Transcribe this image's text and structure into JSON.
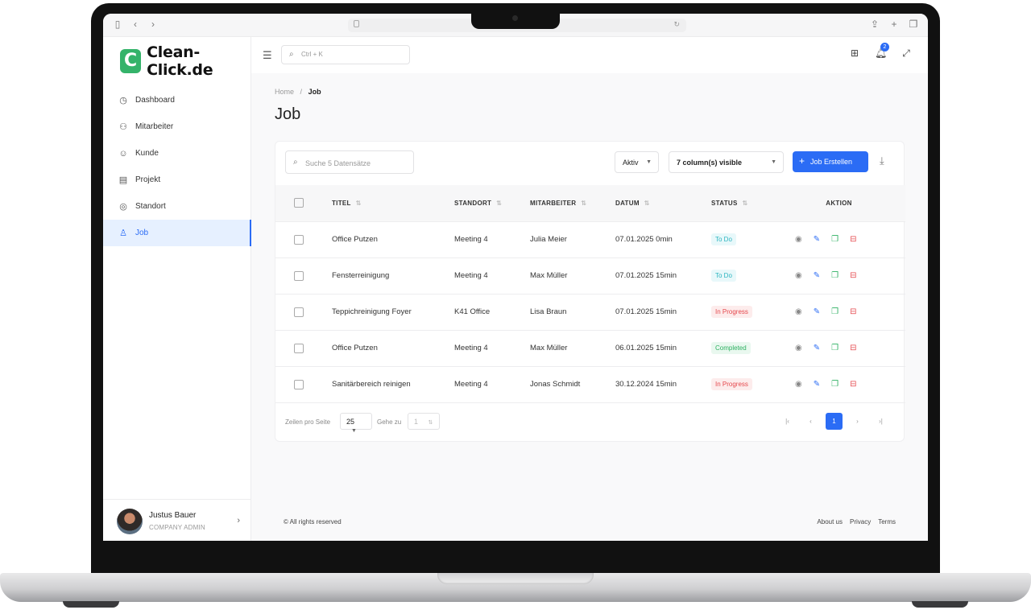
{
  "app": {
    "logo_letter": "C",
    "name": "Clean-Click.de"
  },
  "colors": {
    "brand_green": "#34b36a",
    "accent_blue": "#2b6cf5",
    "danger": "#e5484d"
  },
  "sidebar": {
    "items": [
      {
        "label": "Dashboard",
        "icon": "dashboard-icon"
      },
      {
        "label": "Mitarbeiter",
        "icon": "users-icon"
      },
      {
        "label": "Kunde",
        "icon": "smile-icon"
      },
      {
        "label": "Projekt",
        "icon": "calendar-icon"
      },
      {
        "label": "Standort",
        "icon": "location-pin-icon"
      },
      {
        "label": "Job",
        "icon": "user-icon"
      }
    ],
    "active": "Job",
    "user": {
      "name": "Justus Bauer",
      "role": "COMPANY ADMIN"
    }
  },
  "topbar": {
    "search_placeholder": "Ctrl + K",
    "notifications_count": "2"
  },
  "breadcrumb": {
    "home": "Home",
    "separator": "/",
    "current": "Job"
  },
  "page": {
    "title": "Job"
  },
  "toolbar": {
    "search_placeholder": "Suche 5 Datensätze",
    "status_filter": "Aktiv",
    "columns_visible": "7 column(s) visible",
    "create_button": "Job Erstellen"
  },
  "table": {
    "headers": {
      "title": "TITEL",
      "location": "STANDORT",
      "employee": "MITARBEITER",
      "date": "DATUM",
      "status": "STATUS",
      "action": "AKTION"
    },
    "rows": [
      {
        "title": "Office Putzen",
        "location": "Meeting 4",
        "employee": "Julia Meier",
        "date": "07.01.2025 0min",
        "status": "To Do"
      },
      {
        "title": "Fensterreinigung",
        "location": "Meeting 4",
        "employee": "Max Müller",
        "date": "07.01.2025 15min",
        "status": "To Do"
      },
      {
        "title": "Teppichreinigung Foyer",
        "location": "K41 Office",
        "employee": "Lisa Braun",
        "date": "07.01.2025 15min",
        "status": "In Progress"
      },
      {
        "title": "Office Putzen",
        "location": "Meeting 4",
        "employee": "Max Müller",
        "date": "06.01.2025 15min",
        "status": "Completed"
      },
      {
        "title": "Sanitärbereich reinigen",
        "location": "Meeting 4",
        "employee": "Jonas Schmidt",
        "date": "30.12.2024 15min",
        "status": "In Progress"
      }
    ],
    "status_colors": {
      "To Do": {
        "fg": "#2cb5c0",
        "bg": "#e8f8fa"
      },
      "In Progress": {
        "fg": "#e5484d",
        "bg": "#fdecec"
      },
      "Completed": {
        "fg": "#2db061",
        "bg": "#e9f8ef"
      }
    }
  },
  "pagination": {
    "rows_per_page_label": "Zeilen pro Seite",
    "rows_per_page": "25",
    "goto_label": "Gehe zu",
    "goto_value": "1",
    "current_page": "1"
  },
  "footer": {
    "copyright": "© All rights reserved",
    "links": [
      "About us",
      "Privacy",
      "Terms"
    ]
  }
}
